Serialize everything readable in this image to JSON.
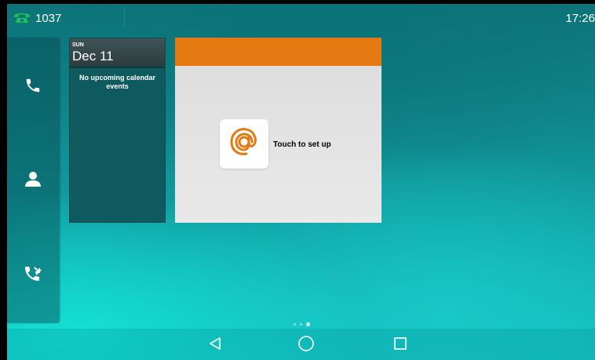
{
  "status_bar": {
    "line_number": "1037",
    "time": "17:26",
    "line_icon": "phone-registered-icon",
    "line_icon_color": "#1fbf5a"
  },
  "dock": {
    "items": [
      {
        "icon": "phone-icon"
      },
      {
        "icon": "contacts-icon"
      },
      {
        "icon": "call-history-icon"
      }
    ]
  },
  "calendar": {
    "day": "SUN",
    "date": "Dec 11",
    "empty_message": "No upcoming calendar events"
  },
  "email": {
    "icon": "at-sign-icon",
    "accent_color": "#e57a12",
    "setup_text": "Touch to set up"
  },
  "pager": {
    "pages": 3,
    "active_index": 2
  },
  "nav_bar": {
    "items": [
      {
        "icon": "back-triangle-icon"
      },
      {
        "icon": "home-circle-icon"
      },
      {
        "icon": "recents-square-icon"
      }
    ]
  }
}
